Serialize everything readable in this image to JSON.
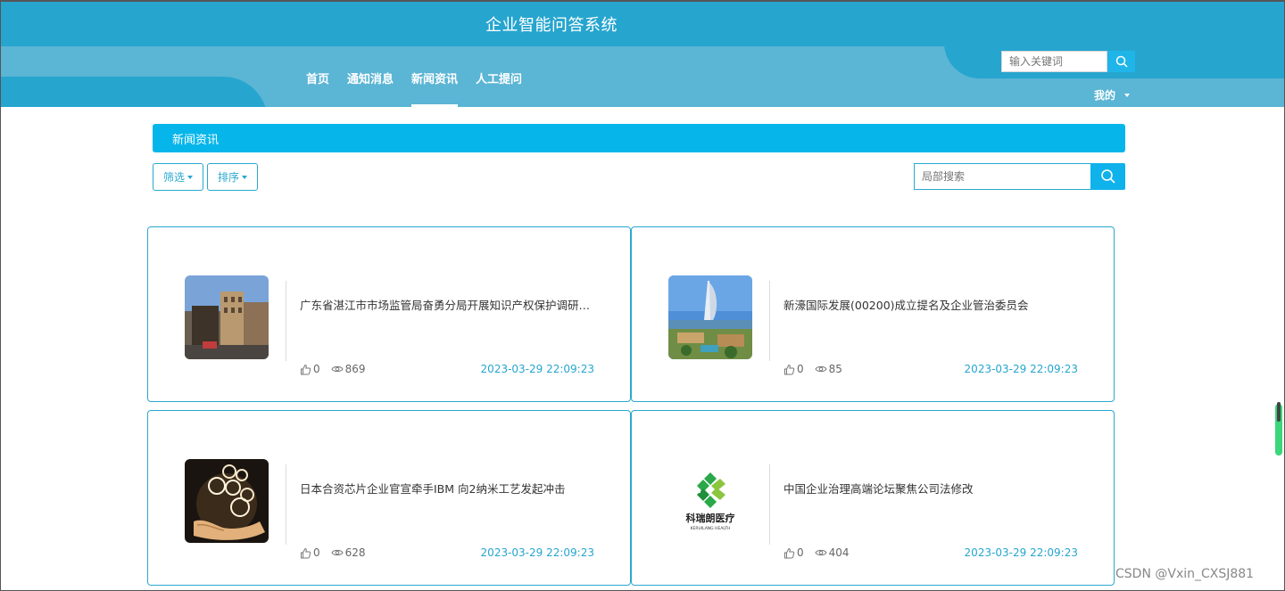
{
  "site": {
    "title": "企业智能问答系统"
  },
  "nav": [
    {
      "label": "首页"
    },
    {
      "label": "通知消息"
    },
    {
      "label": "新闻资讯",
      "active": true
    },
    {
      "label": "人工提问"
    }
  ],
  "top_search": {
    "placeholder": "输入关键词",
    "icon": "search-icon"
  },
  "user_menu": {
    "label": "我的",
    "icon": "caret-down-icon"
  },
  "section": {
    "title": "新闻资讯"
  },
  "filters": {
    "filter_label": "筛选",
    "sort_label": "排序"
  },
  "local_search": {
    "placeholder": "局部搜索",
    "icon": "search-icon"
  },
  "news": [
    {
      "title": "广东省湛江市市场监管局奋勇分局开展知识产权保护调研…",
      "likes": "0",
      "views": "869",
      "date": "2023-03-29 22:09:23",
      "image": "street-photo"
    },
    {
      "title": "新濠国际发展(00200)成立提名及企业管治委员会",
      "likes": "0",
      "views": "85",
      "date": "2023-03-29 22:09:23",
      "image": "dubai-photo"
    },
    {
      "title": "日本合资芯片企业官宣牵手IBM 向2纳米工艺发起冲击",
      "likes": "0",
      "views": "628",
      "date": "2023-03-29 22:09:23",
      "image": "money-hands-photo"
    },
    {
      "title": "中国企业治理高端论坛聚焦公司法修改",
      "likes": "0",
      "views": "404",
      "date": "2023-03-29 22:09:23",
      "image": "keruilang-logo",
      "logo_text": "科瑞朗医疗",
      "logo_sub": "KERUILANG HEALTH"
    }
  ],
  "colors": {
    "header": "#26a5cf",
    "header_light": "#5bb5d4",
    "accent": "#06b6eb",
    "date": "#26a5cf"
  },
  "watermark": "CSDN @Vxin_CXSJ881"
}
